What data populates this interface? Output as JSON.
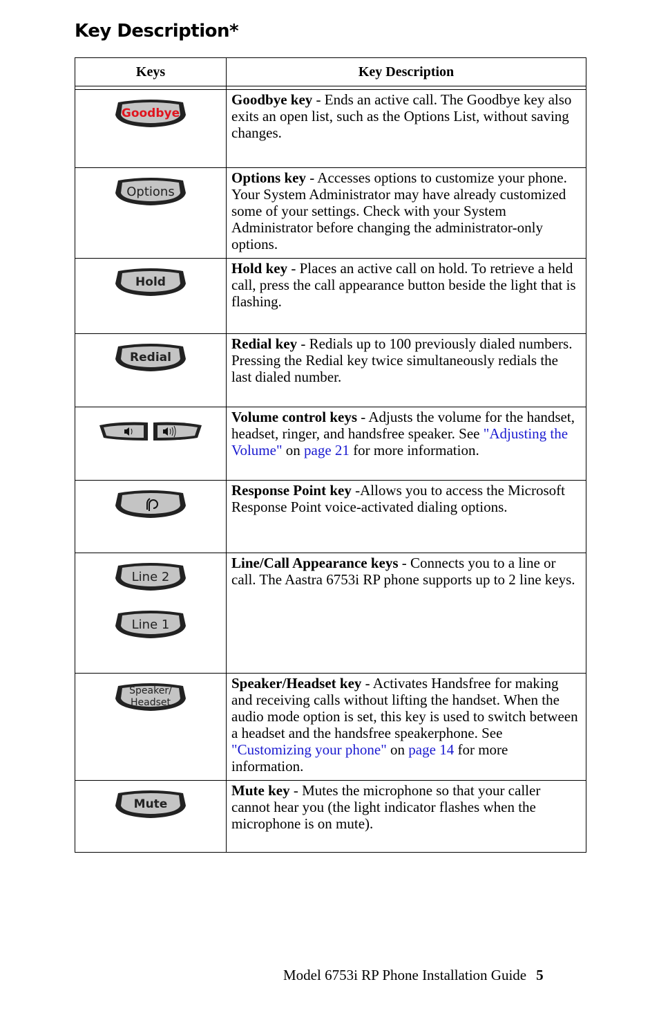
{
  "title": "Key Description*",
  "table": {
    "headers": [
      "Keys",
      "Key Description"
    ],
    "rows": [
      {
        "keys": [
          "Goodbye"
        ],
        "name": "Goodbye key",
        "text": " - Ends an active call. The Goodbye key also exits an open list, such as the Options List, without saving changes."
      },
      {
        "keys": [
          "Options"
        ],
        "name": "Options key",
        "text": " - Accesses options to customize your phone. Your System Administrator may have already customized some of your settings. Check with your System Administrator before changing the administrator-only options."
      },
      {
        "keys": [
          "Hold"
        ],
        "name": "Hold key",
        "text": " - Places an active call on hold. To retrieve a held call, press the call appearance button beside the light that is flashing."
      },
      {
        "keys": [
          "Redial"
        ],
        "name": "Redial key",
        "text": " - Redials up to 100 previously dialed numbers. Pressing the Redial key twice simultaneously redials the last dialed number."
      },
      {
        "keys": [
          "volume-down-icon",
          "volume-up-icon"
        ],
        "name": "Volume control keys",
        "text": " - Adjusts the volume for the handset, headset, ringer, and handsfree speaker. See ",
        "link1": "\"Adjusting the Volume\"",
        "mid": " on ",
        "link2": "page 21",
        "end": " for more information."
      },
      {
        "keys": [
          "response-point-icon"
        ],
        "name": "Response Point key",
        "text": " -Allows you to access the Microsoft Response Point voice-activated dialing options."
      },
      {
        "keys": [
          "Line 2",
          "Line 1"
        ],
        "name": "Line/Call Appearance keys",
        "text": " - Connects you to a line or call. The Aastra 6753i RP phone supports up to 2 line keys."
      },
      {
        "keys": [
          "Speaker/",
          "Headset"
        ],
        "name": "Speaker/Headset key",
        "text": " - Activates Handsfree for making and receiving calls without lifting the handset. When the audio mode option is set, this key is used to switch between a headset and the handsfree speakerphone. See ",
        "link1": "\"Customizing your phone\"",
        "mid": " on ",
        "link2": "page 14",
        "end": " for more information."
      },
      {
        "keys": [
          "Mute"
        ],
        "name": "Mute key",
        "text": " - Mutes the microphone so that your caller cannot hear you (the light indicator flashes when the microphone is on mute)."
      }
    ]
  },
  "colors": {
    "goodbye_label": "#e0141e",
    "link": "#1a1ad0"
  },
  "footer": {
    "text": "Model 6753i RP Phone Installation Guide",
    "page": "5"
  }
}
